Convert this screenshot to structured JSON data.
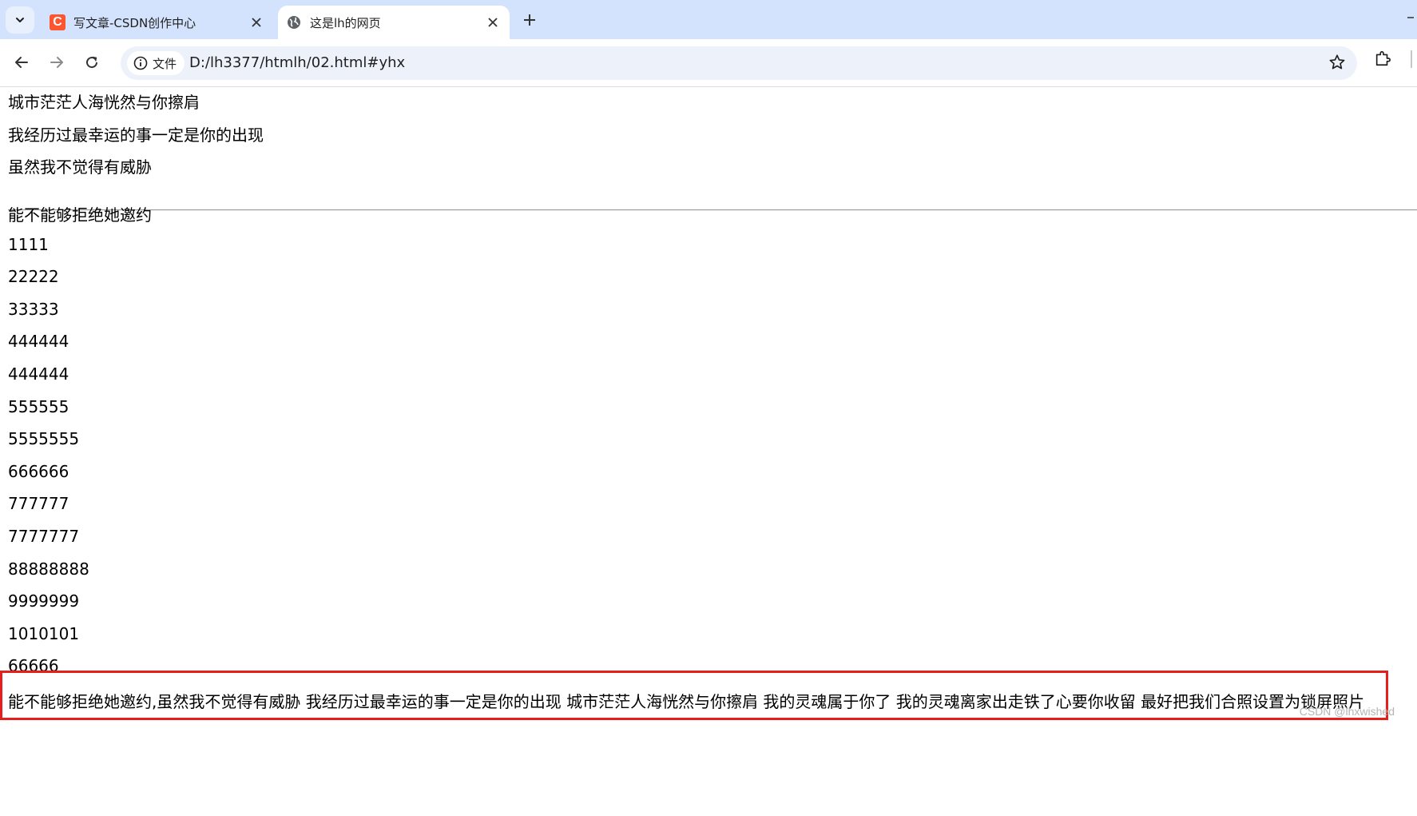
{
  "tabs": [
    {
      "title": "写文章-CSDN创作中心",
      "icon": "csdn-icon",
      "icon_letter": "C",
      "active": false
    },
    {
      "title": "这是lh的网页",
      "icon": "globe-icon",
      "active": true
    }
  ],
  "toolbar": {
    "site_info_label": "文件",
    "url": "D:/lh3377/htmlh/02.html#yhx"
  },
  "content": {
    "lines_top": [
      "城市茫茫人海恍然与你擦肩",
      "我经历过最幸运的事一定是你的出现",
      "虽然我不觉得有威胁"
    ],
    "lines_bottom": [
      "能不能够拒绝她邀约",
      "1111",
      "22222",
      "33333",
      "444444",
      "444444",
      "555555",
      "5555555",
      "666666",
      "777777",
      "7777777",
      "88888888",
      "9999999",
      "1010101",
      "66666"
    ],
    "highlighted_line": "能不能够拒绝她邀约,虽然我不觉得有威胁 我经历过最幸运的事一定是你的出现 城市茫茫人海恍然与你擦肩 我的灵魂属于你了 我的灵魂离家出走铁了心要你收留 最好把我们合照设置为锁屏照片",
    "watermark": "CSDN @lhxwished"
  },
  "colors": {
    "tabstrip_bg": "#d3e3fd",
    "omnibox_bg": "#edf2fa",
    "highlight_border": "#e5201c",
    "csdn_brand": "#fc5531"
  }
}
